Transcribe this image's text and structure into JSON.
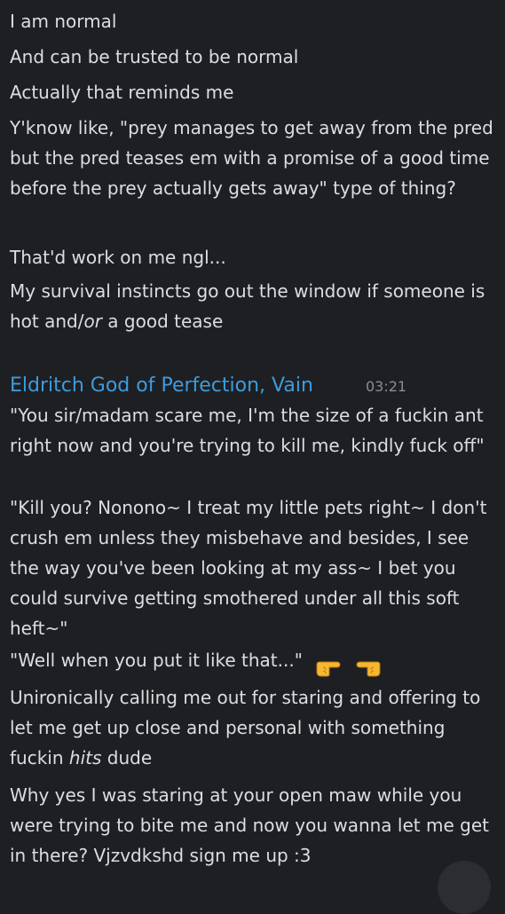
{
  "messages_top": [
    "I am normal",
    "And can be trusted to be normal",
    "Actually that reminds me",
    "Y'know like, \"prey manages to get away from the pred but the pred teases em with a promise of a good time before the prey actually gets away\" type of thing?",
    "That'd work on me ngl...",
    {
      "before": "My survival instincts go out the window if someone is hot and/",
      "italic": "or",
      "after": " a good tease"
    }
  ],
  "group2": {
    "username": "Eldritch God of Perfection, Vain",
    "timestamp": "03:21",
    "username_color": "#3d9bde"
  },
  "messages_bottom": [
    "\"You sir/madam scare me, I'm the size of a fuckin ant right now and you're trying to kill me, kindly fuck off\"",
    "\"Kill you? Nonono~ I treat my little pets right~ I don't crush em unless they misbehave and besides, I see the way you've been looking at my ass~ I bet you could survive getting smothered under all this soft heft~\"",
    {
      "text": "\"Well when you put it like that...\"",
      "emojis": [
        "point-right-icon",
        "point-left-icon"
      ]
    },
    {
      "before": "Unironically calling me out for staring and offering to let me get up close and personal with something fuckin ",
      "italic": "hits",
      "after": " dude"
    },
    "Why yes I was staring at your open maw while you were trying to bite me and now you wanna let me get in there? Vjzvdkshd sign me up :3"
  ]
}
